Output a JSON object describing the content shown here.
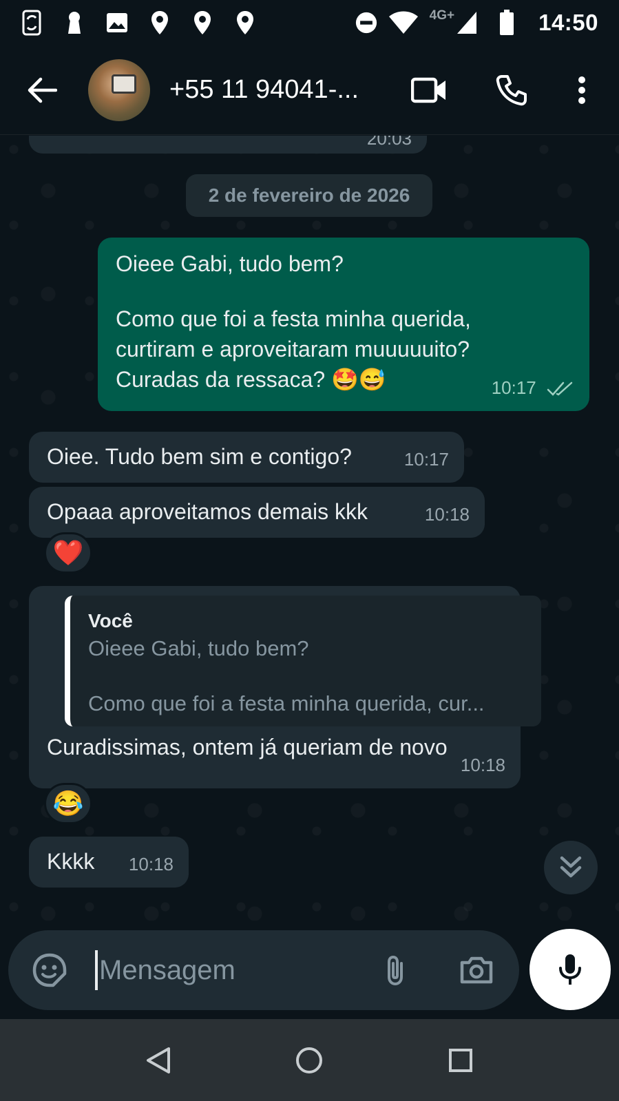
{
  "status_bar": {
    "time": "14:50",
    "network": "4G+",
    "icons": [
      "data-saver-icon",
      "keyhole-icon",
      "image-icon",
      "location-pin-icon",
      "location-pin-icon",
      "location-pin-icon",
      "dnd-icon",
      "wifi-icon",
      "signal-icon",
      "battery-icon"
    ]
  },
  "header": {
    "contact_name": "+55 11 94041-...",
    "icons": [
      "back-arrow-icon",
      "video-call-icon",
      "phone-icon",
      "more-vert-icon"
    ]
  },
  "chat": {
    "previous_time": "20:03",
    "date_chip": "2 de fevereiro de 2026",
    "messages": [
      {
        "direction": "out",
        "line1": "Oieee Gabi, tudo bem?",
        "line2": "Como que foi a festa minha querida,",
        "line3": "curtiram e aproveitaram muuuuuito?",
        "line4": "Curadas da ressaca? 🤩😅",
        "time": "10:17",
        "status": "read"
      },
      {
        "direction": "in",
        "text": "Oiee. Tudo bem sim e contigo?",
        "time": "10:17"
      },
      {
        "direction": "in",
        "text": "Opaaa aproveitamos demais kkk",
        "time": "10:18",
        "reaction": "❤️"
      },
      {
        "direction": "in",
        "quote_author": "Você",
        "quote_line1": "Oieee Gabi, tudo bem?",
        "quote_line2": "Como que foi a festa minha querida, cur...",
        "text": "Curadissimas, ontem já queriam de novo",
        "time": "10:18",
        "reaction": "😂"
      },
      {
        "direction": "in",
        "text": "Kkkk",
        "time": "10:18"
      }
    ]
  },
  "composer": {
    "placeholder": "Mensagem",
    "icons": [
      "sticker-icon",
      "attach-icon",
      "camera-icon",
      "mic-icon"
    ]
  },
  "nav_bar": {
    "icons": [
      "nav-back-icon",
      "nav-home-icon",
      "nav-recents-icon"
    ]
  },
  "colors": {
    "background": "#0b141a",
    "incoming_bubble": "#1f2c34",
    "outgoing_bubble": "#005c4b",
    "secondary_text": "#8696a0"
  }
}
